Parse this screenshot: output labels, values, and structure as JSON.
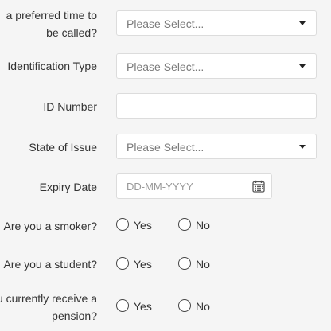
{
  "form": {
    "preferred_time": {
      "label_line1": "a preferred time to",
      "label_line2": "be called?",
      "placeholder": "Please Select..."
    },
    "identification_type": {
      "label": "Identification Type",
      "placeholder": "Please Select..."
    },
    "id_number": {
      "label": "ID Number",
      "value": ""
    },
    "state_of_issue": {
      "label": "State of Issue",
      "placeholder": "Please Select..."
    },
    "expiry_date": {
      "label": "Expiry Date",
      "placeholder": "DD-MM-YYYY",
      "icon": "calendar-icon"
    },
    "smoker": {
      "label": "Are you a smoker?",
      "yes_label": "Yes",
      "no_label": "No"
    },
    "student": {
      "label": "Are you a student?",
      "yes_label": "Yes",
      "no_label": "No"
    },
    "pension": {
      "label_line1": "u currently receive a",
      "label_line2": "pension?",
      "yes_label": "Yes",
      "no_label": "No"
    }
  },
  "colors": {
    "background": "#f5f5f5",
    "field_background": "#ffffff",
    "field_border": "#dcdcdc",
    "text": "#333333",
    "placeholder": "#7a7a7a"
  }
}
